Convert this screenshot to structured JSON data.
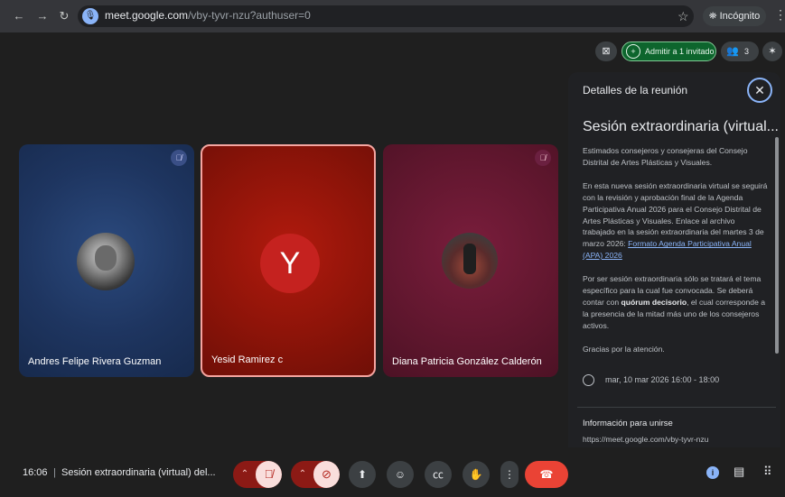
{
  "browser": {
    "url_host": "meet.google.com",
    "url_path": "/vby-tyvr-nzu?authuser=0",
    "incognito_label": "Incógnito"
  },
  "topbar": {
    "admit_label": "Admitir a 1 invitado",
    "people_count": "3"
  },
  "participants": [
    {
      "name": "Andres Felipe Rivera Guzman",
      "muted": true
    },
    {
      "name": "Yesid Ramirez c",
      "initial": "Y",
      "speaking": true
    },
    {
      "name": "Diana Patricia González Calderón",
      "muted": true
    }
  ],
  "panel": {
    "heading": "Detalles de la reunión",
    "meeting_title": "Sesión extraordinaria (virtual...",
    "p1": "Estimados consejeros y consejeras del Consejo Distrital de Artes Plásticas y Visuales.",
    "p2_text": "En esta nueva sesión extraordinaria virtual se seguirá con la revisión y aprobación final de la Agenda Participativa Anual 2026 para el Consejo Distrital de Artes Plásticas y Visuales. Enlace al archivo trabajado en la sesión extraordinaria del martes 3 de marzo 2026: ",
    "p2_link": "Formato Agenda Participativa Anual (APA) 2026",
    "p3_a": "Por ser sesión extraordinaria sólo se tratará el tema específico para la cual fue convocada. Se deberá contar con ",
    "p3_bold": "quórum decisorio",
    "p3_b": ", el cual corresponde a la presencia de la mitad más uno de los consejeros activos.",
    "p4": "Gracias por la atención.",
    "datetime": "mar, 10 mar 2026 16:00 - 18:00",
    "join_heading": "Información para unirse",
    "join_url": "https://meet.google.com/vby-tyvr-nzu"
  },
  "bottombar": {
    "time": "16:06",
    "separator": "|",
    "meeting_title": "Sesión extraordinaria (virtual) del..."
  },
  "colors": {
    "accent": "#8ab4f8",
    "hangup": "#ea4335",
    "admit_bg": "#0d652d",
    "muted_btn": "#f9dedc"
  }
}
